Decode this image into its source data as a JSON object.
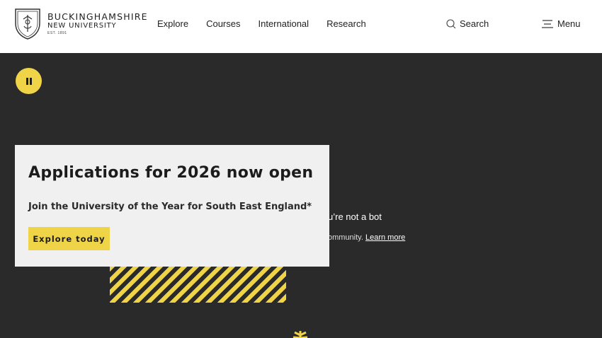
{
  "header": {
    "logo": {
      "line1": "BUCKINGHAMSHIRE",
      "line2": "NEW UNIVERSITY",
      "line3": "EST. 1891"
    },
    "nav": [
      {
        "label": "Explore"
      },
      {
        "label": "Courses"
      },
      {
        "label": "International"
      },
      {
        "label": "Research"
      }
    ],
    "search_label": "Search",
    "menu_label": "Menu"
  },
  "hero": {
    "bot_heading": "u’re not a bot",
    "bot_sub": "ommunity. ",
    "bot_link": "Learn more"
  },
  "promo": {
    "title": "Applications for 2026 now open",
    "subtitle": "Join the University of the Year for South East England*",
    "button": "Explore today"
  },
  "colors": {
    "accent": "#f0d448",
    "hero_bg": "#2a2a2a",
    "card_bg": "#f0f0f0"
  }
}
